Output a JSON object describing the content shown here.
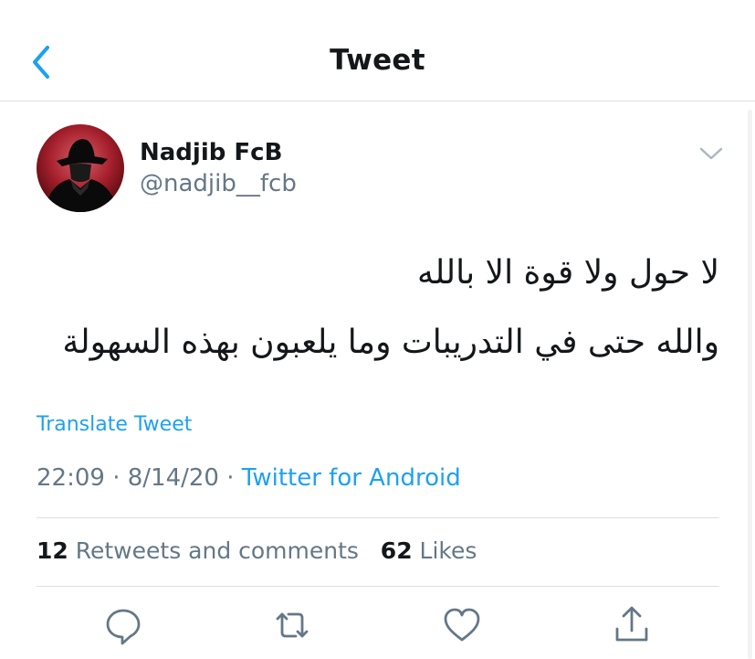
{
  "header": {
    "title": "Tweet",
    "back_icon": "chevron-left-icon",
    "accent_color": "#1da1f2"
  },
  "tweet": {
    "author": {
      "display_name": "Nadjib FcB",
      "handle": "@nadjib__fcb",
      "avatar": "avatar-silhouette-fedora"
    },
    "text_lines": [
      "لا حول ولا قوة الا بالله",
      "والله حتى في التدريبات وما يلعبون بهذه السهولة"
    ],
    "translate_label": "Translate Tweet",
    "time": "22:09",
    "date": "8/14/20",
    "separator": "·",
    "source": "Twitter for Android"
  },
  "stats": {
    "retweets_count": "12",
    "retweets_label": "Retweets and comments",
    "likes_count": "62",
    "likes_label": "Likes"
  },
  "actions": [
    {
      "name": "reply",
      "icon": "comment-icon"
    },
    {
      "name": "retweet",
      "icon": "retweet-icon"
    },
    {
      "name": "like",
      "icon": "heart-icon"
    },
    {
      "name": "share",
      "icon": "share-icon"
    }
  ],
  "colors": {
    "text": "#14171a",
    "secondary": "#657786",
    "link": "#1da1f2",
    "divider": "#dcdfe2"
  }
}
